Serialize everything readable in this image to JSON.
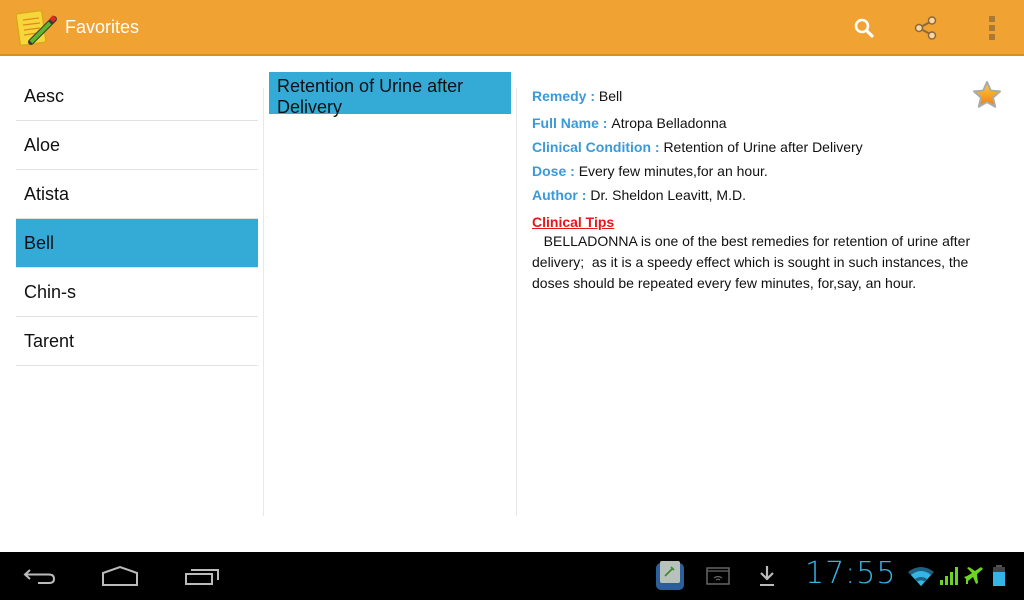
{
  "actionbar": {
    "title": "Favorites",
    "icons": [
      "notes-app-icon",
      "search-icon",
      "share-icon",
      "overflow-menu-icon"
    ],
    "color": "#f0a232"
  },
  "remedies": {
    "items": [
      {
        "label": "Aesc",
        "selected": false
      },
      {
        "label": "Aloe",
        "selected": false
      },
      {
        "label": "Atista",
        "selected": false
      },
      {
        "label": "Bell",
        "selected": true
      },
      {
        "label": "Chin-s",
        "selected": false
      },
      {
        "label": "Tarent",
        "selected": false
      }
    ],
    "selected_color": "#33abd6"
  },
  "conditions": {
    "items": [
      {
        "label": "Retention of Urine after Delivery",
        "selected": true
      }
    ]
  },
  "detail": {
    "remedy_label": "Remedy : ",
    "remedy": "Bell",
    "full_name_label": "Full Name : ",
    "full_name": "Atropa Belladonna",
    "condition_label": "Clinical Condition : ",
    "condition": "Retention of Urine after Delivery",
    "dose_label": "Dose : ",
    "dose": "Every few minutes,for an hour.",
    "author_label": "Author : ",
    "author": "Dr. Sheldon Leavitt, M.D.",
    "tips_title": "Clinical Tips",
    "tips": "   BELLADONNA is one of the best remedies for retention of urine after delivery;  as it is a speedy effect which is sought in such instances, the doses should be repeated every few minutes, for,say, an hour.",
    "favorite": true
  },
  "statusbar": {
    "time": "17:55",
    "icons": [
      "app-notification-icon",
      "wifi-screen-icon",
      "download-icon",
      "wifi-icon",
      "signal-icon",
      "airplane-icon",
      "battery-icon"
    ]
  }
}
